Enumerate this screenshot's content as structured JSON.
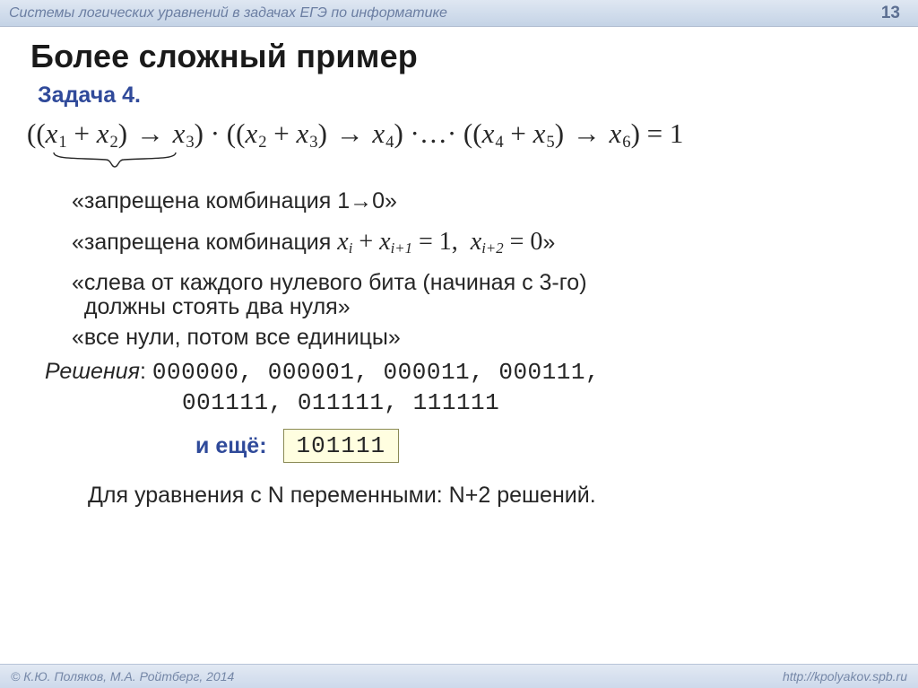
{
  "slide": {
    "topbar_title": "Системы логических уравнений в задачах ЕГЭ по информатике",
    "page_number": "13",
    "heading": "Более сложный пример",
    "task_label": "Задача 4.",
    "equation_html": "((<span class=v>x</span><sub>1</sub> + <span class=v>x</span><sub>2</sub>) <span class=arrow>→</span> <span class=v>x</span><sub>3</sub>) · ((<span class=v>x</span><sub>2</sub> + <span class=v>x</span><sub>3</sub>) <span class=arrow>→</span> <span class=v>x</span><sub>4</sub>) ·…· ((<span class=v>x</span><sub>4</sub> + <span class=v>x</span><sub>5</sub>) <span class=arrow>→</span> <span class=v>x</span><sub>6</sub>) = 1",
    "note1": "«запрещена комбинация 1→0»",
    "note2_pre": "«запрещена комбинация  ",
    "note2_math_html": "<span class=v>x</span><sub>i</sub> + <span class=v>x</span><sub>i+1</sub> = 1,&nbsp;&nbsp;<span class=v>x</span><sub>i+2</sub> = 0",
    "note2_post": "»",
    "note3_line1": "«слева от каждого нулевого бита (начиная с 3-го)",
    "note3_line2": "  должны стоять два нуля»",
    "note4": "«все нули, потом все единицы»",
    "solutions_label": "Решения",
    "solutions_line1": "000000, 000001, 000011, 000111,",
    "solutions_line2": "001111, 011111, 111111",
    "more_label": "и ещё:",
    "more_value": "101111",
    "conclusion": "Для уравнения с N переменными: N+2 решений.",
    "footer_left": "© К.Ю. Поляков, М.А. Ройтберг, 2014",
    "footer_right": "http://kpolyakov.spb.ru"
  }
}
